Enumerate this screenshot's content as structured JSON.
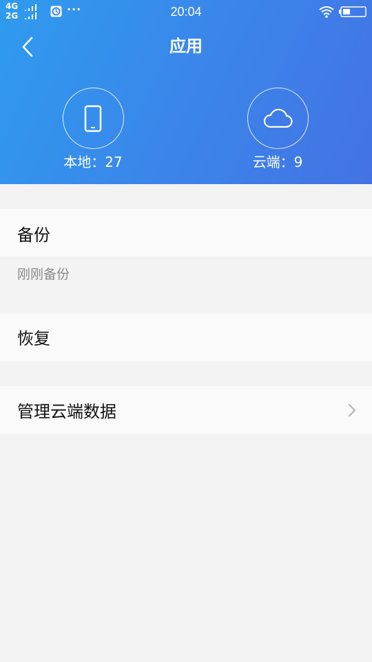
{
  "status_bar": {
    "network_top": "4G",
    "network_bottom": "2G",
    "more": "···",
    "time": "20:04",
    "wifi_icon": "wifi-icon",
    "battery_icon": "battery-icon"
  },
  "header": {
    "title": "应用",
    "back_icon": "chevron-left-icon",
    "gradient_start": "#2f9bef",
    "gradient_end": "#4472e4"
  },
  "stats": {
    "local": {
      "icon": "phone-icon",
      "label": "本地",
      "separator": "：",
      "count": "27"
    },
    "cloud": {
      "icon": "cloud-icon",
      "label": "云端",
      "separator": "：",
      "count": "9"
    }
  },
  "actions": {
    "backup": {
      "label": "备份",
      "last_time": "刚刚备份"
    },
    "restore": {
      "label": "恢复"
    },
    "manage": {
      "label": "管理云端数据",
      "chevron_icon": "chevron-right-icon"
    }
  }
}
